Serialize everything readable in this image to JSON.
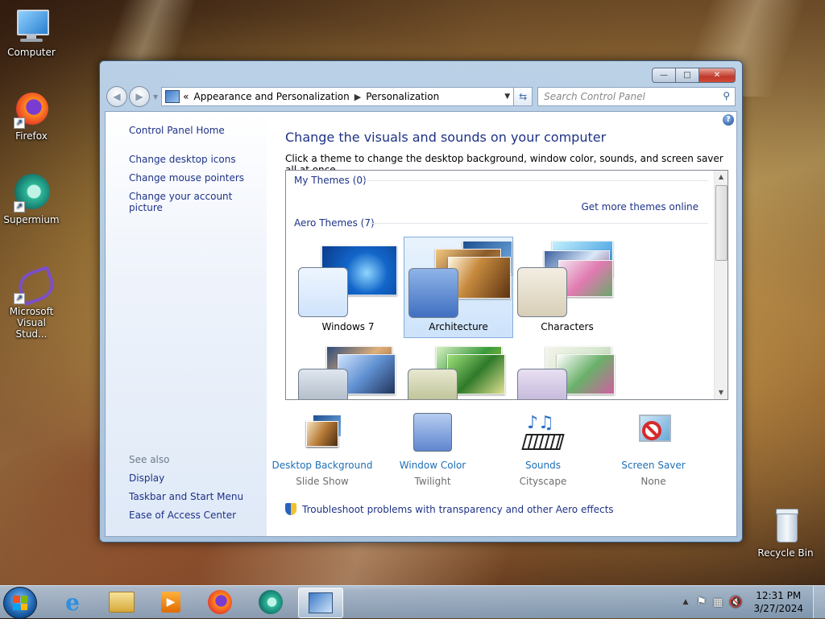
{
  "desktop": {
    "icons": [
      {
        "label": "Computer"
      },
      {
        "label": "Firefox"
      },
      {
        "label": "Supermium"
      },
      {
        "label": "Microsoft Visual Stud..."
      },
      {
        "label": "Recycle Bin"
      }
    ]
  },
  "window": {
    "controls": {
      "minimize": "—",
      "maximize": "□",
      "close": "✕"
    },
    "address": {
      "prefix": "«",
      "crumb1": "Appearance and Personalization",
      "crumb2": "Personalization"
    },
    "search": {
      "placeholder": "Search Control Panel"
    },
    "sidebar": {
      "home": "Control Panel Home",
      "links": [
        "Change desktop icons",
        "Change mouse pointers",
        "Change your account picture"
      ],
      "see_also": "See also",
      "see_also_links": [
        "Display",
        "Taskbar and Start Menu",
        "Ease of Access Center"
      ]
    },
    "main": {
      "title": "Change the visuals and sounds on your computer",
      "subtitle": "Click a theme to change the desktop background, window color, sounds, and screen saver all at once.",
      "my_themes": "My Themes (0)",
      "get_more": "Get more themes online",
      "aero_themes": "Aero Themes (7)",
      "themes": [
        {
          "name": "Windows 7",
          "selected": false
        },
        {
          "name": "Architecture",
          "selected": true
        },
        {
          "name": "Characters",
          "selected": false
        }
      ],
      "options": [
        {
          "label": "Desktop Background",
          "value": "Slide Show"
        },
        {
          "label": "Window Color",
          "value": "Twilight"
        },
        {
          "label": "Sounds",
          "value": "Cityscape"
        },
        {
          "label": "Screen Saver",
          "value": "None"
        }
      ],
      "troubleshoot": "Troubleshoot problems with transparency and other Aero effects"
    }
  },
  "taskbar": {
    "time": "12:31 PM",
    "date": "3/27/2024"
  }
}
